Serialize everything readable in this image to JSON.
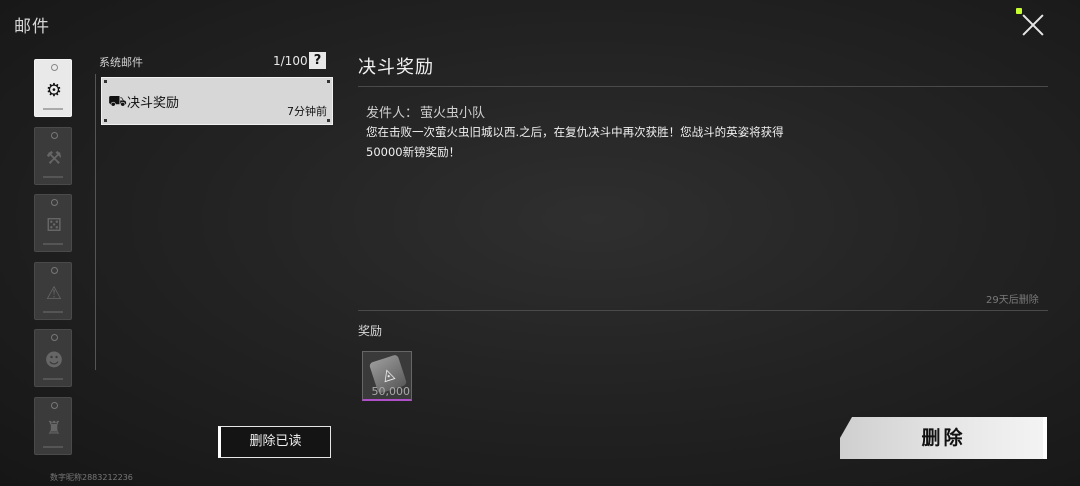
{
  "window": {
    "title": "邮件"
  },
  "categories": [
    {
      "icon": "gear-icon",
      "active": true
    },
    {
      "icon": "hammer-icon",
      "active": false
    },
    {
      "icon": "dice-icon",
      "active": false
    },
    {
      "icon": "warning-icon",
      "active": false
    },
    {
      "icon": "character-icon",
      "active": false
    },
    {
      "icon": "backpack-icon",
      "active": false
    }
  ],
  "mail_list": {
    "label": "系统邮件",
    "count": "1/100",
    "help_glyph": "?",
    "items": [
      {
        "subject": "决斗奖励",
        "time": "7分钟前",
        "icon": "truck-icon"
      }
    ]
  },
  "buttons": {
    "delete_read": "删除已读",
    "delete": "删除"
  },
  "user_id": "数字昵称2883212236",
  "detail": {
    "title": "决斗奖励",
    "sender_label": "发件人：",
    "sender_name": "萤火虫小队",
    "body_line1": "您在击败一次萤火虫旧城以西.之后，在复仇决斗中再次获胜！您战斗的英姿将获得",
    "body_line2": "50000新镑奖励！",
    "expire": "29天后删除",
    "reward_label": "奖励",
    "rewards": [
      {
        "icon": "currency-icon",
        "quantity": "50,000",
        "rarity_color": "#b050c8"
      }
    ]
  }
}
